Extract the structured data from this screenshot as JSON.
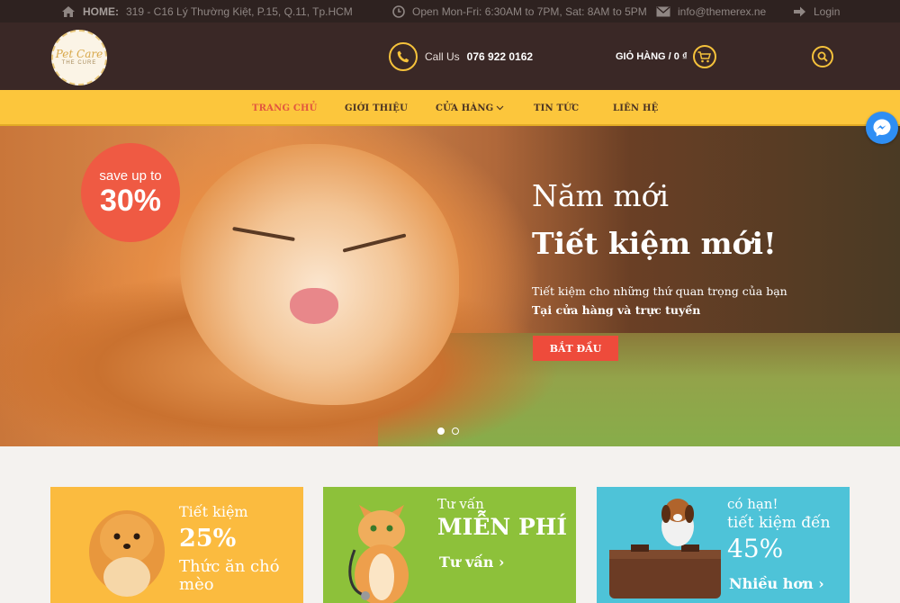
{
  "topbar": {
    "home_label": "HOME:",
    "address": "319 - C16 Lý Thường Kiệt, P.15, Q.11, Tp.HCM",
    "hours": "Open Mon-Fri: 6:30AM to 7PM, Sat: 8AM to 5PM",
    "email": "info@themerex.ne",
    "login": "Login"
  },
  "header": {
    "logo_line1": "Pet Care",
    "logo_line2": "THE CURE",
    "call_label": "Call Us",
    "phone": "076 922 0162",
    "cart_label": "GIỎ HÀNG / 0 ₫"
  },
  "nav": {
    "items": [
      {
        "label": "TRANG CHỦ"
      },
      {
        "label": "GIỚI THIỆU"
      },
      {
        "label": "CỬA HÀNG"
      },
      {
        "label": "TIN TỨC"
      },
      {
        "label": "LIÊN HỆ"
      }
    ]
  },
  "hero": {
    "sale_line1": "save up to",
    "sale_line2": "30%",
    "title_line1": "Năm mới",
    "title_line2": "Tiết kiệm mới!",
    "subtitle_line1": "Tiết kiệm cho những thứ quan trọng của bạn",
    "subtitle_line2": "Tại cửa hàng và trực tuyến",
    "cta": "BẮT ĐẦU"
  },
  "cards": [
    {
      "line1": "Tiết kiệm",
      "line2": "25%",
      "line3": "Thức ăn chó",
      "line4": "mèo"
    },
    {
      "line1": "Tư vấn",
      "line2": "MIỄN PHÍ",
      "line3": "Tư vấn ›"
    },
    {
      "line1": "có hạn!",
      "line2": "tiết kiệm đến",
      "line3": "45%",
      "line4": "Nhiều hơn ›"
    }
  ],
  "colors": {
    "topbar_bg": "#2e2220",
    "header_bg": "#3a2826",
    "nav_bg": "#fcc63c",
    "accent_red": "#ef5a43",
    "accent_yellow": "#f5c23b"
  }
}
